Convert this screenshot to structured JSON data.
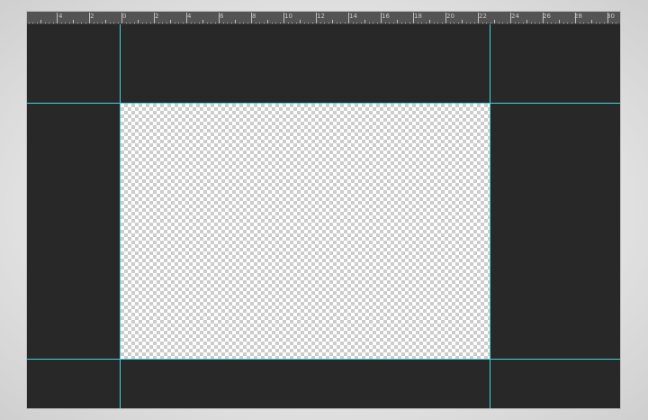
{
  "ruler": {
    "labels": [
      "4",
      "2",
      "0",
      "2",
      "4",
      "6",
      "8",
      "10",
      "12",
      "14",
      "16",
      "18",
      "20",
      "22",
      "24",
      "26",
      "28",
      "30"
    ]
  },
  "canvas": {
    "content": "transparent",
    "checker_light": "#ffffff",
    "checker_dark": "#cccccc"
  },
  "colors": {
    "workspace": "#282828",
    "ruler": "#535353",
    "guide": "#3fd7d7",
    "background": "#e6e6e6"
  }
}
